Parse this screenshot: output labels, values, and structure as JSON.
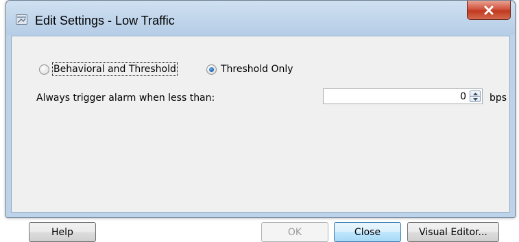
{
  "window": {
    "title": "Edit Settings - Low Traffic",
    "close_icon": "close-x-icon",
    "app_icon": "settings-window-icon"
  },
  "mode": {
    "options": [
      {
        "label": "Behavioral and Threshold",
        "checked": false
      },
      {
        "label": "Threshold Only",
        "checked": true
      }
    ]
  },
  "alarm": {
    "label": "Always trigger alarm when less than:",
    "value": "0",
    "unit": "bps"
  },
  "buttons": {
    "help": "Help",
    "ok": "OK",
    "close": "Close",
    "visual_editor": "Visual Editor..."
  },
  "colors": {
    "title_bar": "#c4d8ec",
    "close_button": "#c9482f",
    "dialog_body": "#f0f0f0",
    "default_button": "#bee6fd"
  }
}
